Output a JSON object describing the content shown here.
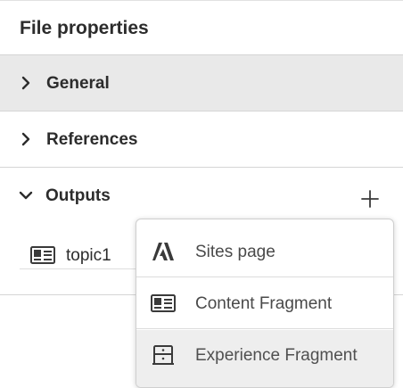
{
  "panel": {
    "title": "File properties",
    "sections": {
      "general": {
        "label": "General",
        "expanded": false
      },
      "references": {
        "label": "References",
        "expanded": false
      },
      "outputs": {
        "label": "Outputs",
        "expanded": true
      }
    },
    "outputs": [
      {
        "name": "topic1",
        "icon": "content-fragment-icon"
      }
    ]
  },
  "add_menu": {
    "items": [
      {
        "label": "Sites page",
        "icon": "adobe-logo-icon"
      },
      {
        "label": "Content Fragment",
        "icon": "content-fragment-icon"
      },
      {
        "label": "Experience Fragment",
        "icon": "experience-fragment-icon",
        "hovered": true
      }
    ]
  },
  "colors": {
    "text": "#2c2c2c",
    "section_active_bg": "#e9e9e9",
    "menu_hover_bg": "#eeeeee",
    "divider": "#d5d5d5"
  }
}
